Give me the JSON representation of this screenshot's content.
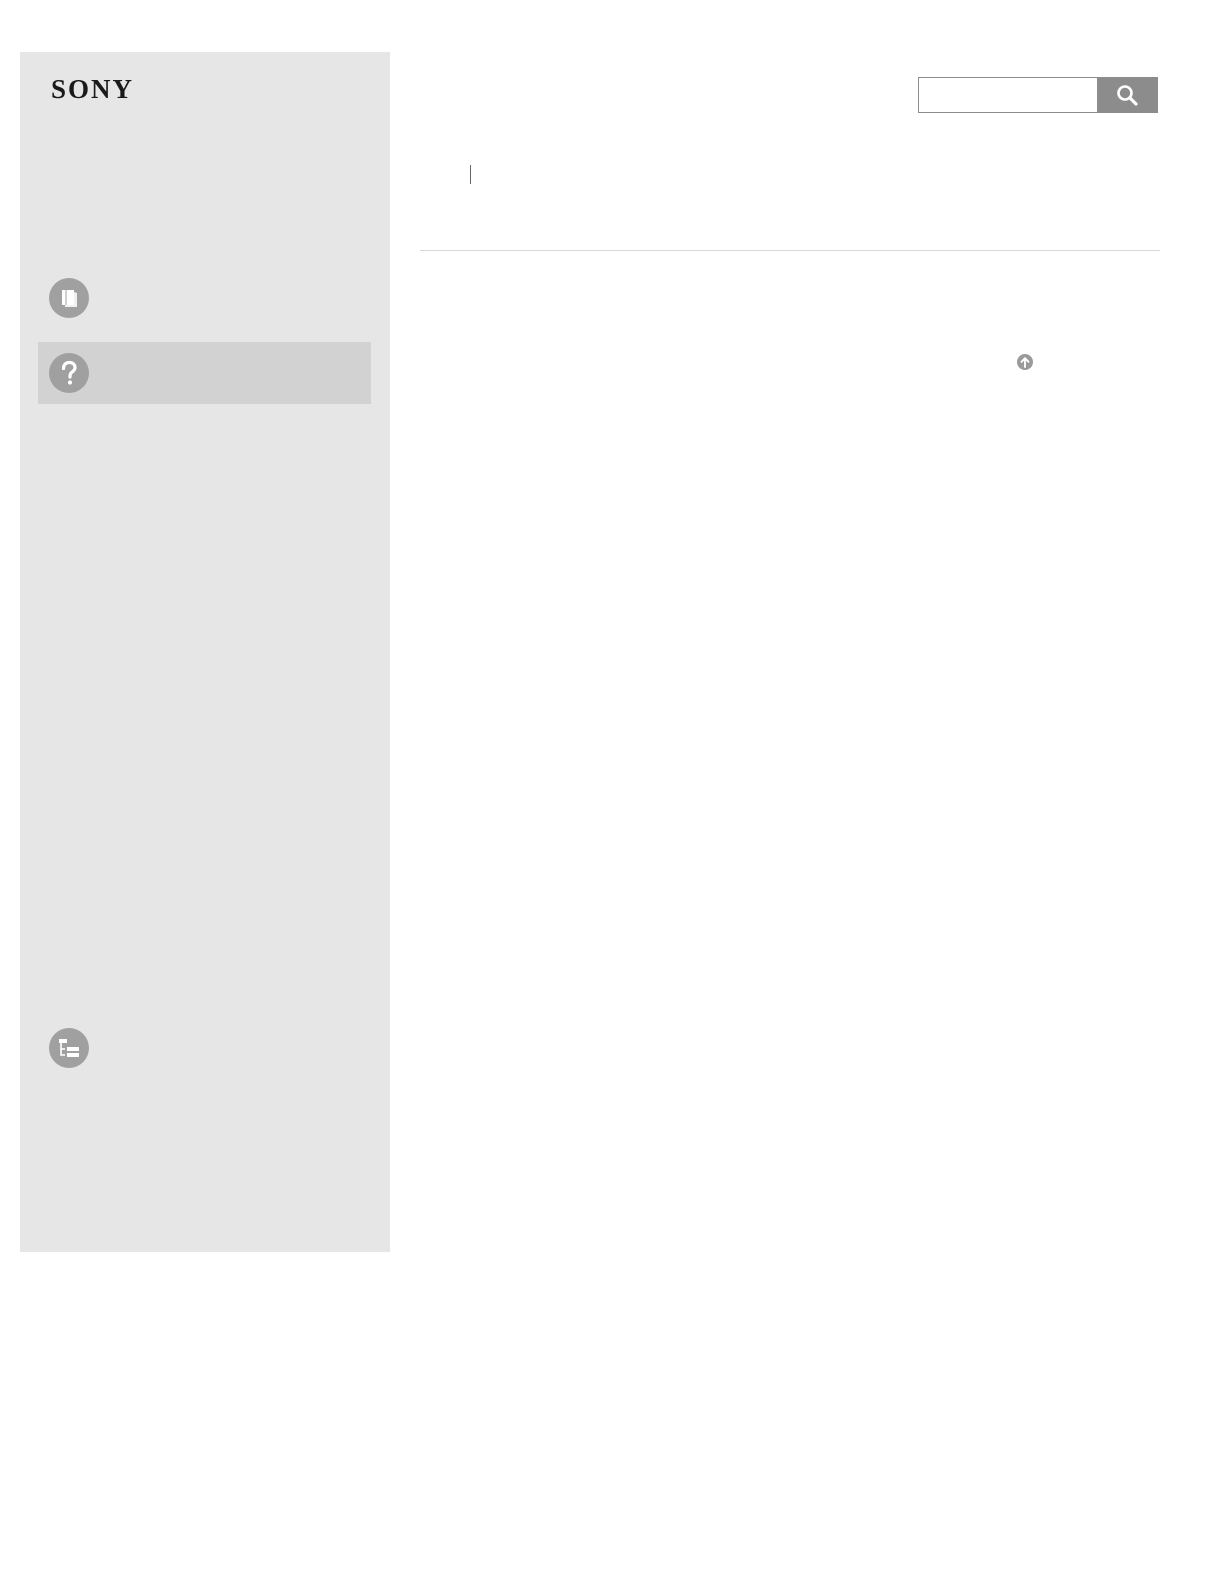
{
  "brand": {
    "logo_text": "SONY"
  },
  "sidebar": {
    "items": [
      {
        "icon": "book-icon",
        "label": "",
        "selected": false
      },
      {
        "icon": "question-icon",
        "label": "",
        "selected": true
      },
      {
        "icon": "list-tree-icon",
        "label": "",
        "selected": false
      }
    ]
  },
  "search": {
    "placeholder": "",
    "value": "",
    "button_icon": "search-icon"
  },
  "breadcrumb": {
    "items": [
      "",
      ""
    ]
  },
  "back_to_top": {
    "icon": "arrow-up-circle-icon"
  },
  "colors": {
    "sidebar_bg": "#e6e6e6",
    "selected_item_bg": "#d2d2d2",
    "icon_bg": "#a0a0a0",
    "search_button_bg": "#8c8c8c"
  }
}
